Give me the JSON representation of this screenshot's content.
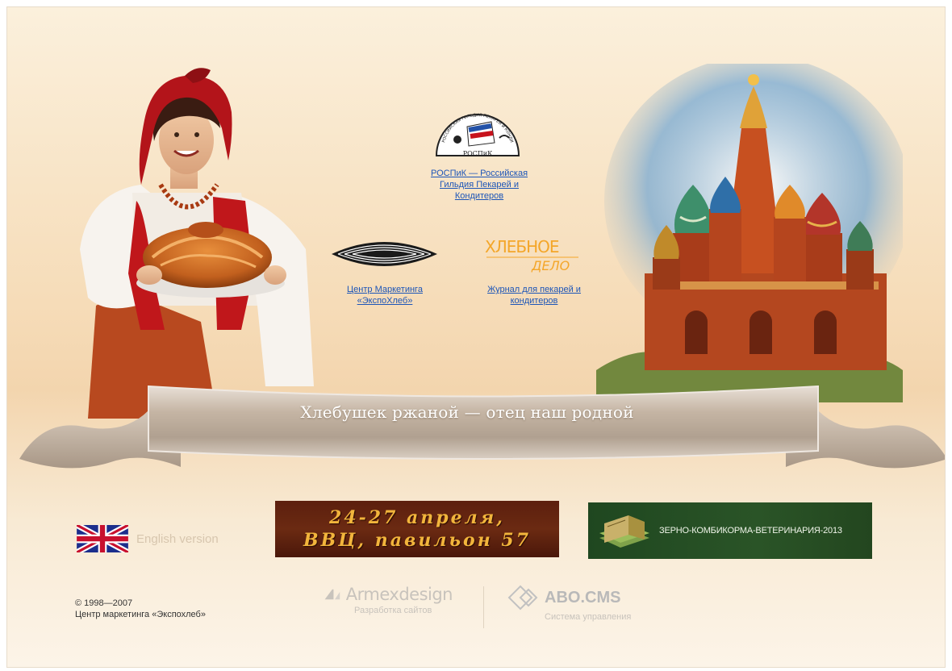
{
  "logos": {
    "rospik_text": "РОССИЙСКАЯ ГИЛЬДИЯ ПЕКАРЕЙ И КОНДИТЕРОВ",
    "rospik_short": "РОСПиК",
    "xd_line1": "ХЛЕБНОЕ",
    "xd_line2": "ДЕЛО"
  },
  "links": {
    "rospik": "РОСПиК — Российская Гильдия Пекарей и Кондитеров",
    "expo": "Центр Маркетинга «ЭкспоХлеб»",
    "xd": "Журнал для пекарей и кондитеров"
  },
  "ribbon": {
    "text": "Хлебушек ржаной — отец наш родной"
  },
  "english": {
    "label": "English version"
  },
  "banner1": {
    "line1": "24-27 апреля,",
    "line2": "ВВЦ, павильон 57"
  },
  "banner2": {
    "label": "ЗЕРНО-КОМБИКОРМА-ВЕТЕРИНАРИЯ-2013"
  },
  "footer": {
    "copyright_years": "© 1998—2007",
    "copyright_org": "Центр маркетинга «Экспохлеб»",
    "armex_name": "Armexdesign",
    "armex_sub": "Разработка сайтов",
    "abo_name": "ABO.CMS",
    "abo_sub": "Система управления"
  },
  "colors": {
    "link": "#1c55b8",
    "banner1_bg": "#5c1f0e",
    "banner1_text": "#f2b53c",
    "banner2_bg": "#2a5427"
  }
}
